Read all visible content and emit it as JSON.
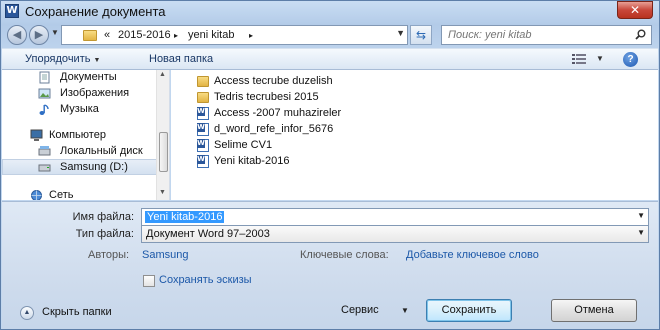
{
  "window": {
    "title": "Сохранение документа",
    "app_icon_letter": "W",
    "close_symbol": "✕"
  },
  "address": {
    "overflow": "«",
    "crumbs": [
      "2015-2016",
      "yeni kitab"
    ],
    "separator": "▸",
    "search_placeholder": "Поиск: yeni kitab"
  },
  "toolbar": {
    "organize_label": "Упорядочить",
    "new_folder_label": "Новая папка",
    "help_symbol": "?"
  },
  "sidebar": {
    "items": [
      {
        "label": "Документы",
        "icon": "documents-icon"
      },
      {
        "label": "Изображения",
        "icon": "pictures-icon"
      },
      {
        "label": "Музыка",
        "icon": "music-icon"
      },
      {
        "label": "Компьютер",
        "icon": "computer-icon"
      },
      {
        "label": "Локальный диск",
        "icon": "drive-icon"
      },
      {
        "label": "Samsung (D:)",
        "icon": "drive-icon",
        "selected": true
      },
      {
        "label": "Сеть",
        "icon": "network-icon"
      }
    ]
  },
  "files": [
    {
      "name": "Access tecrube duzelish",
      "type": "folder"
    },
    {
      "name": "Tedris tecrubesi 2015",
      "type": "folder"
    },
    {
      "name": "Access -2007  muhazireler",
      "type": "word"
    },
    {
      "name": "d_word_refe_infor_5676",
      "type": "word"
    },
    {
      "name": "Selime  CV1",
      "type": "word"
    },
    {
      "name": "Yeni kitab-2016",
      "type": "word"
    }
  ],
  "form": {
    "filename_label": "Имя файла:",
    "filename_value": "Yeni kitab-2016",
    "filetype_label": "Тип файла:",
    "filetype_value": "Документ Word 97–2003",
    "authors_label": "Авторы:",
    "authors_value": "Samsung",
    "keywords_label": "Ключевые слова:",
    "keywords_value": "Добавьте ключевое слово",
    "thumbnails_label": "Сохранять эскизы",
    "thumbnails_checked": false
  },
  "footer": {
    "hide_folders_label": "Скрыть папки",
    "service_label": "Сервис",
    "save_label": "Сохранить",
    "cancel_label": "Отмена"
  },
  "colors": {
    "accent_link": "#1c58a8",
    "selection": "#3399ff",
    "close_button": "#c8473a"
  }
}
